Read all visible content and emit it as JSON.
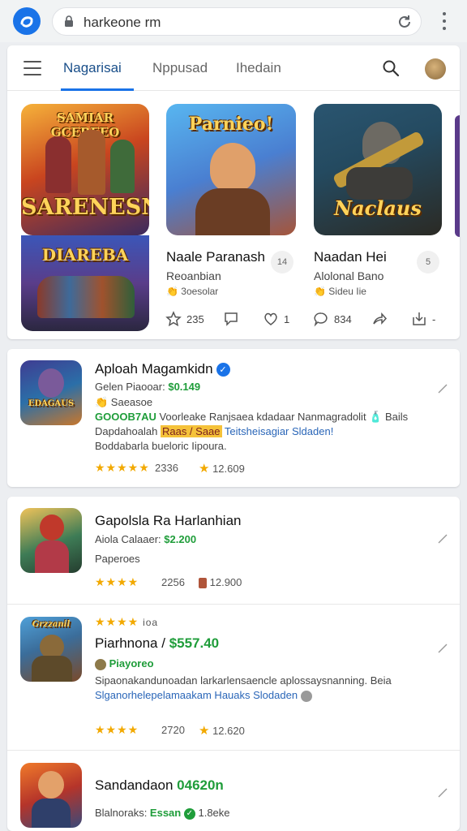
{
  "browser": {
    "url": "harkeone rm",
    "icons": [
      "app-logo-icon",
      "lock-icon",
      "reload-icon",
      "more-vert-icon"
    ]
  },
  "nav": {
    "tabs": [
      {
        "label": "Nagarisai",
        "active": true
      },
      {
        "label": "Nppusad",
        "active": false
      },
      {
        "label": "Ihedain",
        "active": false
      }
    ]
  },
  "featured": {
    "thumb1_top": "SAMIAR GCEREEO",
    "thumb1_bottom": "SARENESN",
    "thumb2": "Parnieo!",
    "thumb3": "Naclaus",
    "thumb4": "DIAREBA",
    "card1": {
      "title": "Naale Paranash",
      "sub": "Reoanbian",
      "meta": "👏 3oesolar",
      "btn": "14"
    },
    "card2": {
      "title": "Naadan Hei",
      "sub": "Alolonal Bano",
      "meta": "👏 Sideu Iie",
      "btn": "5"
    },
    "actions": [
      {
        "icon": "star-icon",
        "value": "235"
      },
      {
        "icon": "comment-icon",
        "value": ""
      },
      {
        "icon": "heart-icon",
        "value": "1"
      },
      {
        "icon": "chat-bubble-icon",
        "value": "834"
      },
      {
        "icon": "share-icon",
        "value": ""
      },
      {
        "icon": "download-icon",
        "value": "-"
      }
    ]
  },
  "list": [
    {
      "title": "Aploah Magamkidn",
      "line1_prefix": "Gelen Piaooar: ",
      "line1_price": "$0.149",
      "line2": "👏 Saeasoe",
      "line3_green": "GOOOB7AU",
      "line3_rest": " Voorleake Ranjsaea kdadaar Nanmagradolit 🧴 Bails",
      "line4_start": "Dapdahoalah ",
      "line4_badges": "Raas / Saae",
      "line4_blue": " Teitsheisagiar Sldaden!",
      "line5": "Boddabarla bueloric Iipoura.",
      "stars": "★★★★★",
      "rating1": "2336",
      "rating2": "12.609",
      "icon_text": "EDAGAUS"
    },
    {
      "title": "Gapolsla Ra Harlanhian",
      "line1_prefix": "Aiola Calaaer: ",
      "line1_price": "$2.200",
      "line2": "Paperoes",
      "stars": "★★★★",
      "rating1": "2256",
      "rating2": "12.900",
      "icon_text": ""
    },
    {
      "title": "Piarhnona / ",
      "title_price": "$557.40",
      "stars_top": "★★★★",
      "stars_top_text": "ioa",
      "line1_green": "Piayoreo",
      "line2": "Sipaonakandunoadan larkarlensaencle aplossaysnanning. Beia",
      "line3_blue": "Slganorhelepelamaakam Hauaks Slodaden",
      "stars": "★★★★",
      "rating1": "2720",
      "rating2": "12.620",
      "icon_text": "Grzzanil"
    },
    {
      "title": "Sandandaon ",
      "title_price": "04620n",
      "line1": "Blalnoraks: ",
      "line1_green": "Essan",
      "line1_rest": "1.8eke",
      "icon_text": ""
    }
  ]
}
